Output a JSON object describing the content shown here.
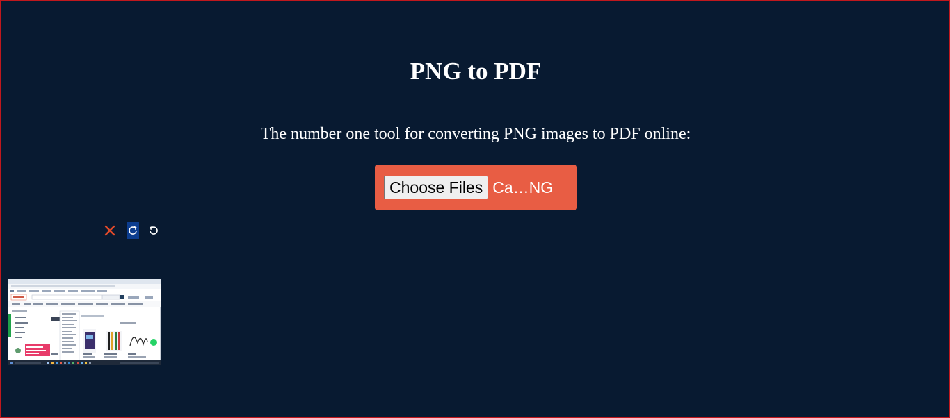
{
  "page": {
    "title": "PNG to PDF",
    "subtitle": "The number one tool for converting PNG images to PDF online:"
  },
  "upload": {
    "choose_label": "Choose Files",
    "file_status": "Ca…NG",
    "background_color": "#e85d44"
  },
  "thumbnail_controls": {
    "remove_icon": "close-icon",
    "rotate_right_icon": "rotate-clockwise-icon",
    "rotate_left_icon": "rotate-counterclockwise-icon"
  },
  "thumbnail": {
    "kind": "uploaded-image-preview"
  },
  "colors": {
    "background": "#081a31",
    "accent": "#e85d44",
    "remove": "#e04a2a",
    "selected": "#0c3d8f"
  }
}
